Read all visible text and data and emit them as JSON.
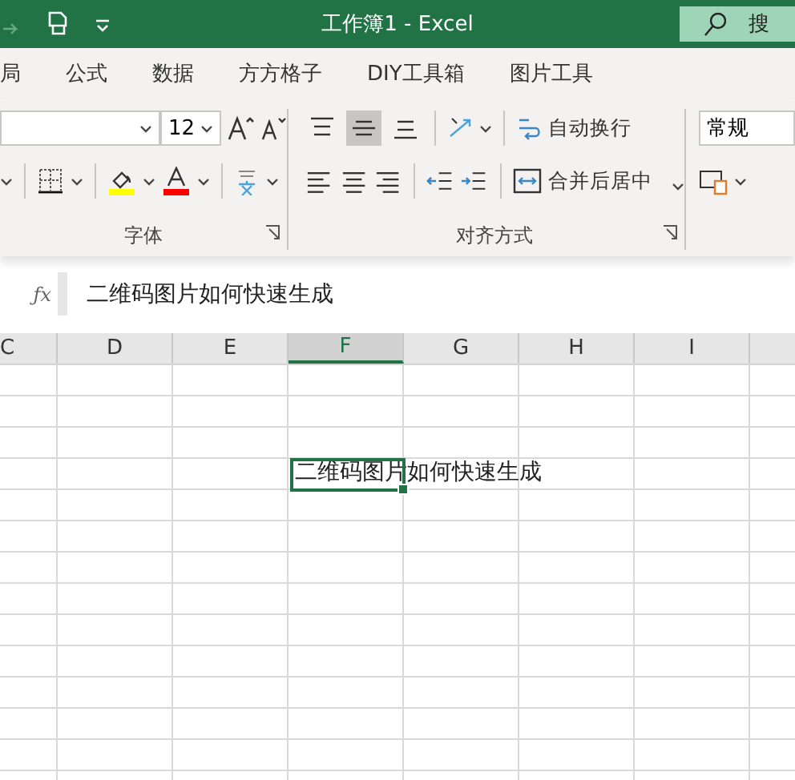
{
  "title_bar": {
    "title": "工作簿1  -  Excel",
    "search_placeholder": "搜"
  },
  "tabs": [
    {
      "label": "局",
      "selected": false
    },
    {
      "label": "公式",
      "selected": false
    },
    {
      "label": "数据",
      "selected": false
    },
    {
      "label": "方方格子",
      "selected": false
    },
    {
      "label": "DIY工具箱",
      "selected": false
    },
    {
      "label": "图片工具",
      "selected": false
    }
  ],
  "font_group": {
    "font_size": "12",
    "label": "字体"
  },
  "alignment_group": {
    "vertical_align": [
      {
        "kind": "top",
        "selected": false
      },
      {
        "kind": "middle",
        "selected": true
      },
      {
        "kind": "bottom",
        "selected": false
      }
    ],
    "wrap_text": "自动换行",
    "merge_center": "合并后居中",
    "label": "对齐方式"
  },
  "number_group": {
    "format": "常规"
  },
  "formula_bar": {
    "fx_label": "ƒx",
    "formula": "二维码图片如何快速生成"
  },
  "columns": [
    {
      "label": "C",
      "selected": false
    },
    {
      "label": "D",
      "selected": false
    },
    {
      "label": "E",
      "selected": false
    },
    {
      "label": "F",
      "selected": true
    },
    {
      "label": "G",
      "selected": false
    },
    {
      "label": "H",
      "selected": false
    },
    {
      "label": "I",
      "selected": false
    }
  ],
  "active_cell": {
    "text": "二维码图片如何快速生成"
  }
}
